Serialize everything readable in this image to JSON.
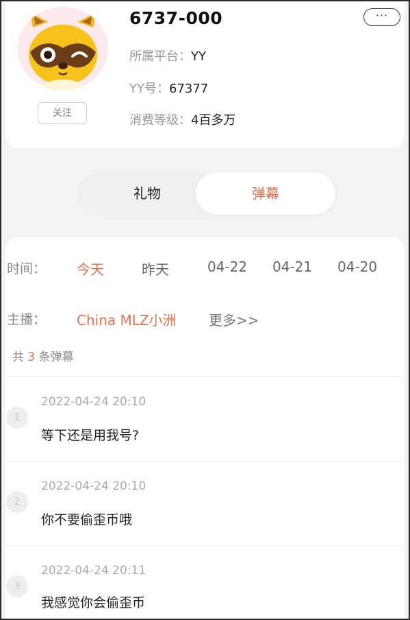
{
  "profile": {
    "name": "6737-000",
    "follow_label": "关注",
    "more_label": "···",
    "platform_label": "所属平台：",
    "platform_value": "YY",
    "yy_id_label": "YY号：",
    "yy_id_value": "67377",
    "level_label": "消费等级：",
    "level_value": "4百多万"
  },
  "tabs": [
    {
      "label": "礼物",
      "active": false
    },
    {
      "label": "弹幕",
      "active": true
    }
  ],
  "filters": {
    "time_label": "时间：",
    "dates": [
      {
        "label": "今天",
        "active": true
      },
      {
        "label": "昨天",
        "active": false
      },
      {
        "label": "04-22",
        "active": false
      },
      {
        "label": "04-21",
        "active": false
      },
      {
        "label": "04-20",
        "active": false
      }
    ],
    "host_label": "主播：",
    "host_name": "China MLZ小洲",
    "host_more": "更多>>"
  },
  "summary": {
    "prefix": "共",
    "count": "3",
    "suffix": "条弹幕"
  },
  "messages": [
    {
      "index": "1",
      "time": "2022-04-24 20:10",
      "text": "等下还是用我号?"
    },
    {
      "index": "2",
      "time": "2022-04-24 20:10",
      "text": "你不要偷歪币哦"
    },
    {
      "index": "3",
      "time": "2022-04-24 20:11",
      "text": "我感觉你会偷歪币"
    }
  ],
  "colors": {
    "accent": "#e3714d",
    "background": "#f3f3f3",
    "card": "#ffffff"
  },
  "icons": {
    "avatar": "raccoon-mascot-icon"
  }
}
